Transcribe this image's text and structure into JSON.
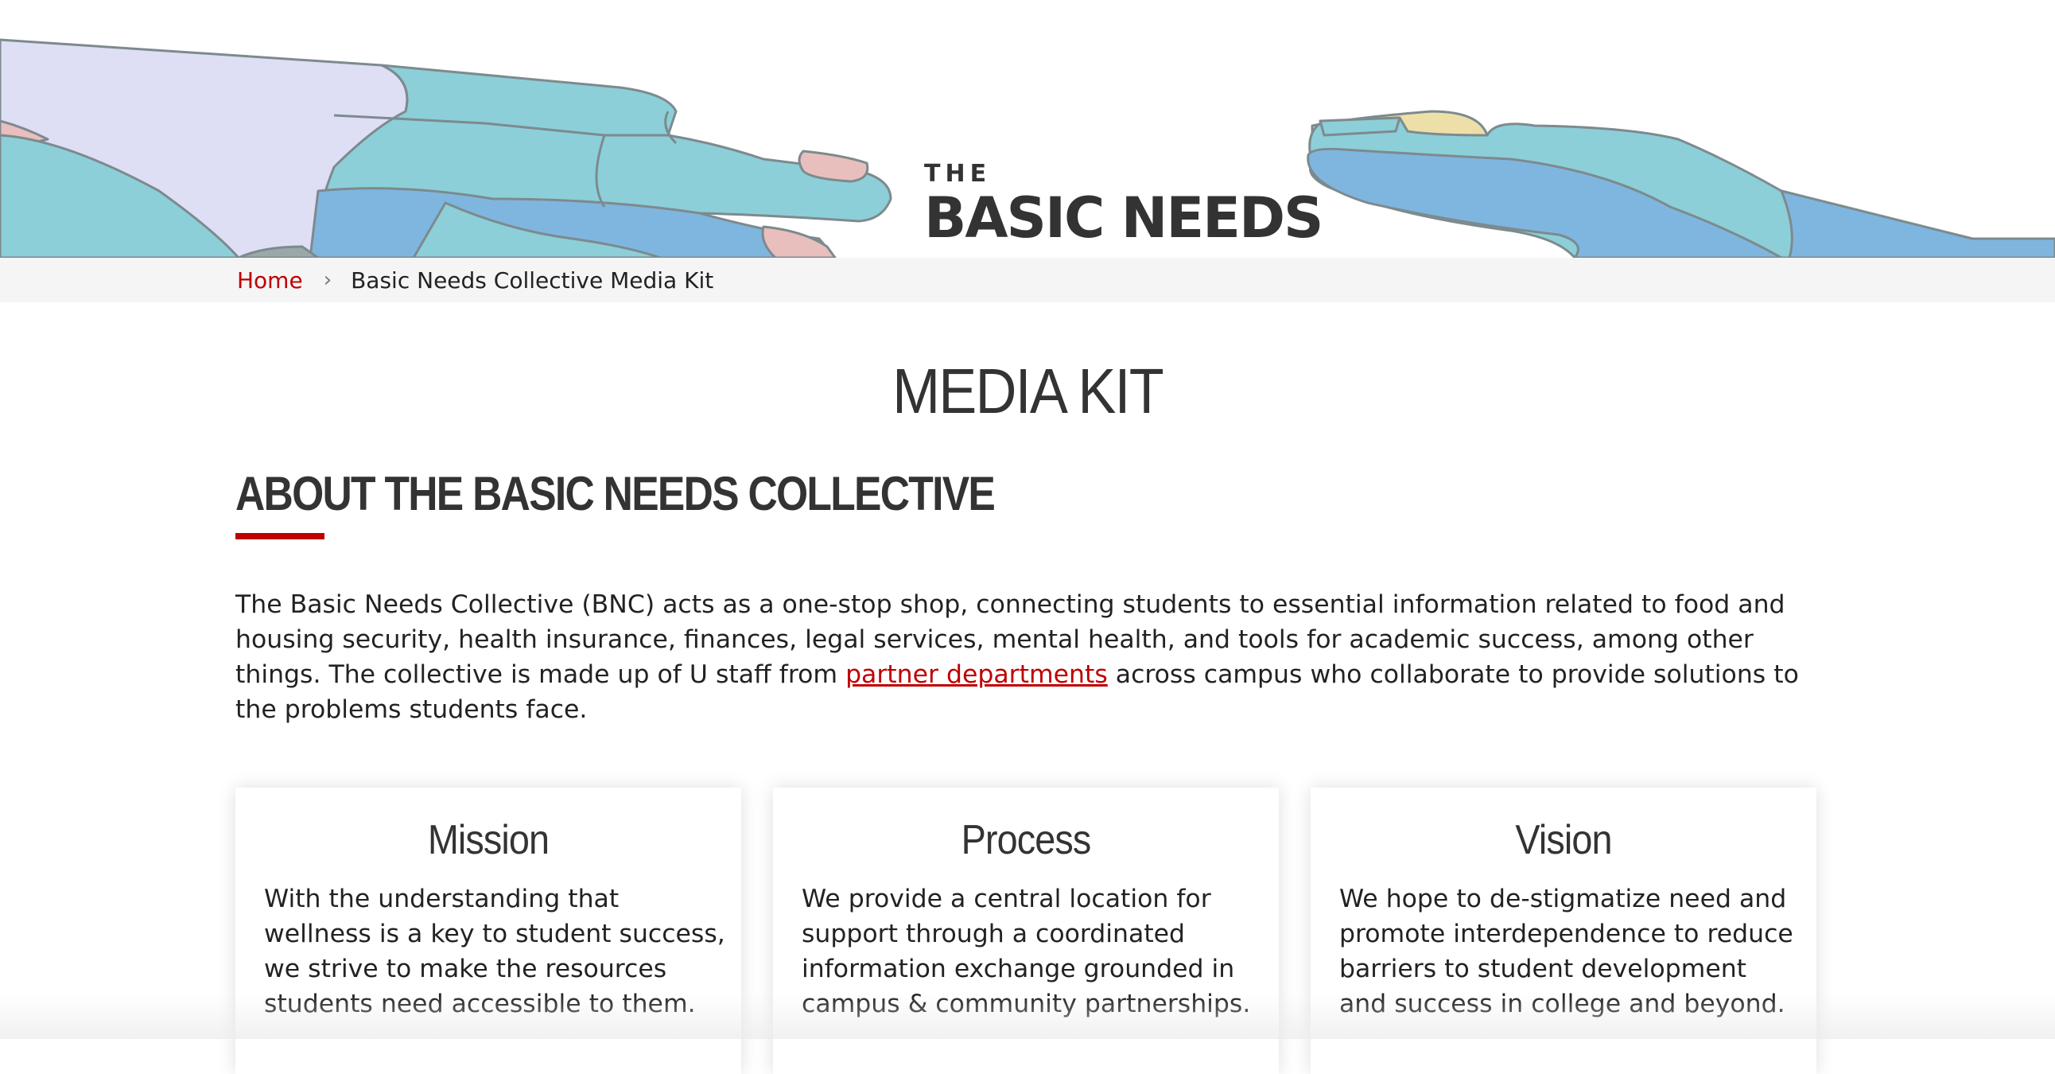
{
  "header": {
    "logo_top": "THE",
    "logo_main": "BASIC NEEDS"
  },
  "breadcrumb": {
    "home": "Home",
    "separator": "›",
    "current": "Basic Needs Collective Media Kit"
  },
  "page_title": "MEDIA KIT",
  "about": {
    "heading": "ABOUT THE BASIC NEEDS COLLECTIVE",
    "text_before_link": "The Basic Needs Collective (BNC) acts as a one-stop shop, connecting students to essential information related to food and housing security, health insurance, finances, legal services, mental health, and tools for academic success, among other things. The collective is made up of U staff from ",
    "link_text": "partner departments",
    "text_after_link": " across campus who collaborate to provide solutions to the problems students face."
  },
  "cards": [
    {
      "title": "Mission",
      "body": "With the understanding that wellness is a key to student success, we strive to make the resources students need accessible to them."
    },
    {
      "title": "Process",
      "body": "We provide a central location for support through a coordinated information exchange grounded in campus & community partnerships."
    },
    {
      "title": "Vision",
      "body": "We hope to de-stigmatize need and promote interdependence to reduce barriers to student development and success in college and beyond."
    }
  ],
  "colors": {
    "accent_red": "#be0000",
    "hand_teal": "#8ccfd8",
    "hand_blue": "#7fb6df",
    "sleeve_lavender": "#dedff5",
    "fingernail_pink": "#e8bfbd",
    "thumb_yellow": "#eddfa8"
  }
}
